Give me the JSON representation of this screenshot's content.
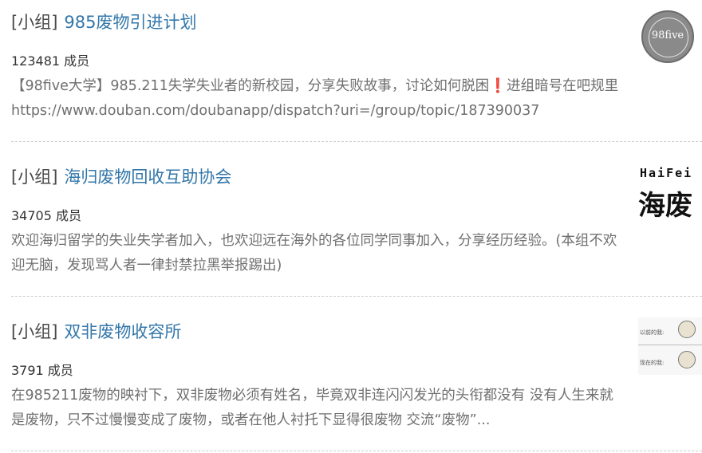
{
  "groups": [
    {
      "tag": "[小组]",
      "name": "985废物引进计划",
      "members": "123481 成员",
      "desc_before": "【98five大学】985.211失学失业者的新校园，分享失败故事，讨论如何脱困",
      "desc_mark": "❗",
      "desc_after": "进组暗号在吧规里https://www.douban.com/doubanapp/dispatch?uri=/group/topic/187390037",
      "thumb_text": "98five",
      "thumb_icon": "school-seal-icon"
    },
    {
      "tag": "[小组]",
      "name": "海归废物回收互助协会",
      "members": "34705 成员",
      "desc": "欢迎海归留学的失业失学者加入，也欢迎远在海外的各位同学同事加入，分享经历经验。(本组不欢迎无脑，发现骂人者一律封禁拉黑举报踢出)",
      "thumb_top": "HaiFei",
      "thumb_big": "海废"
    },
    {
      "tag": "[小组]",
      "name": "双非废物收容所",
      "members": "3791 成员",
      "desc": "在985211废物的映衬下，双非废物必须有姓名，毕竟双非连闪闪发光的头衔都没有 没有人生来就是废物，只不过慢慢变成了废物，或者在他人衬托下显得很废物 交流“废物”...",
      "thumb_icon": "meme-comic-icon",
      "thumb_row1": "以前的我:",
      "thumb_row2": "现在的我:"
    }
  ]
}
